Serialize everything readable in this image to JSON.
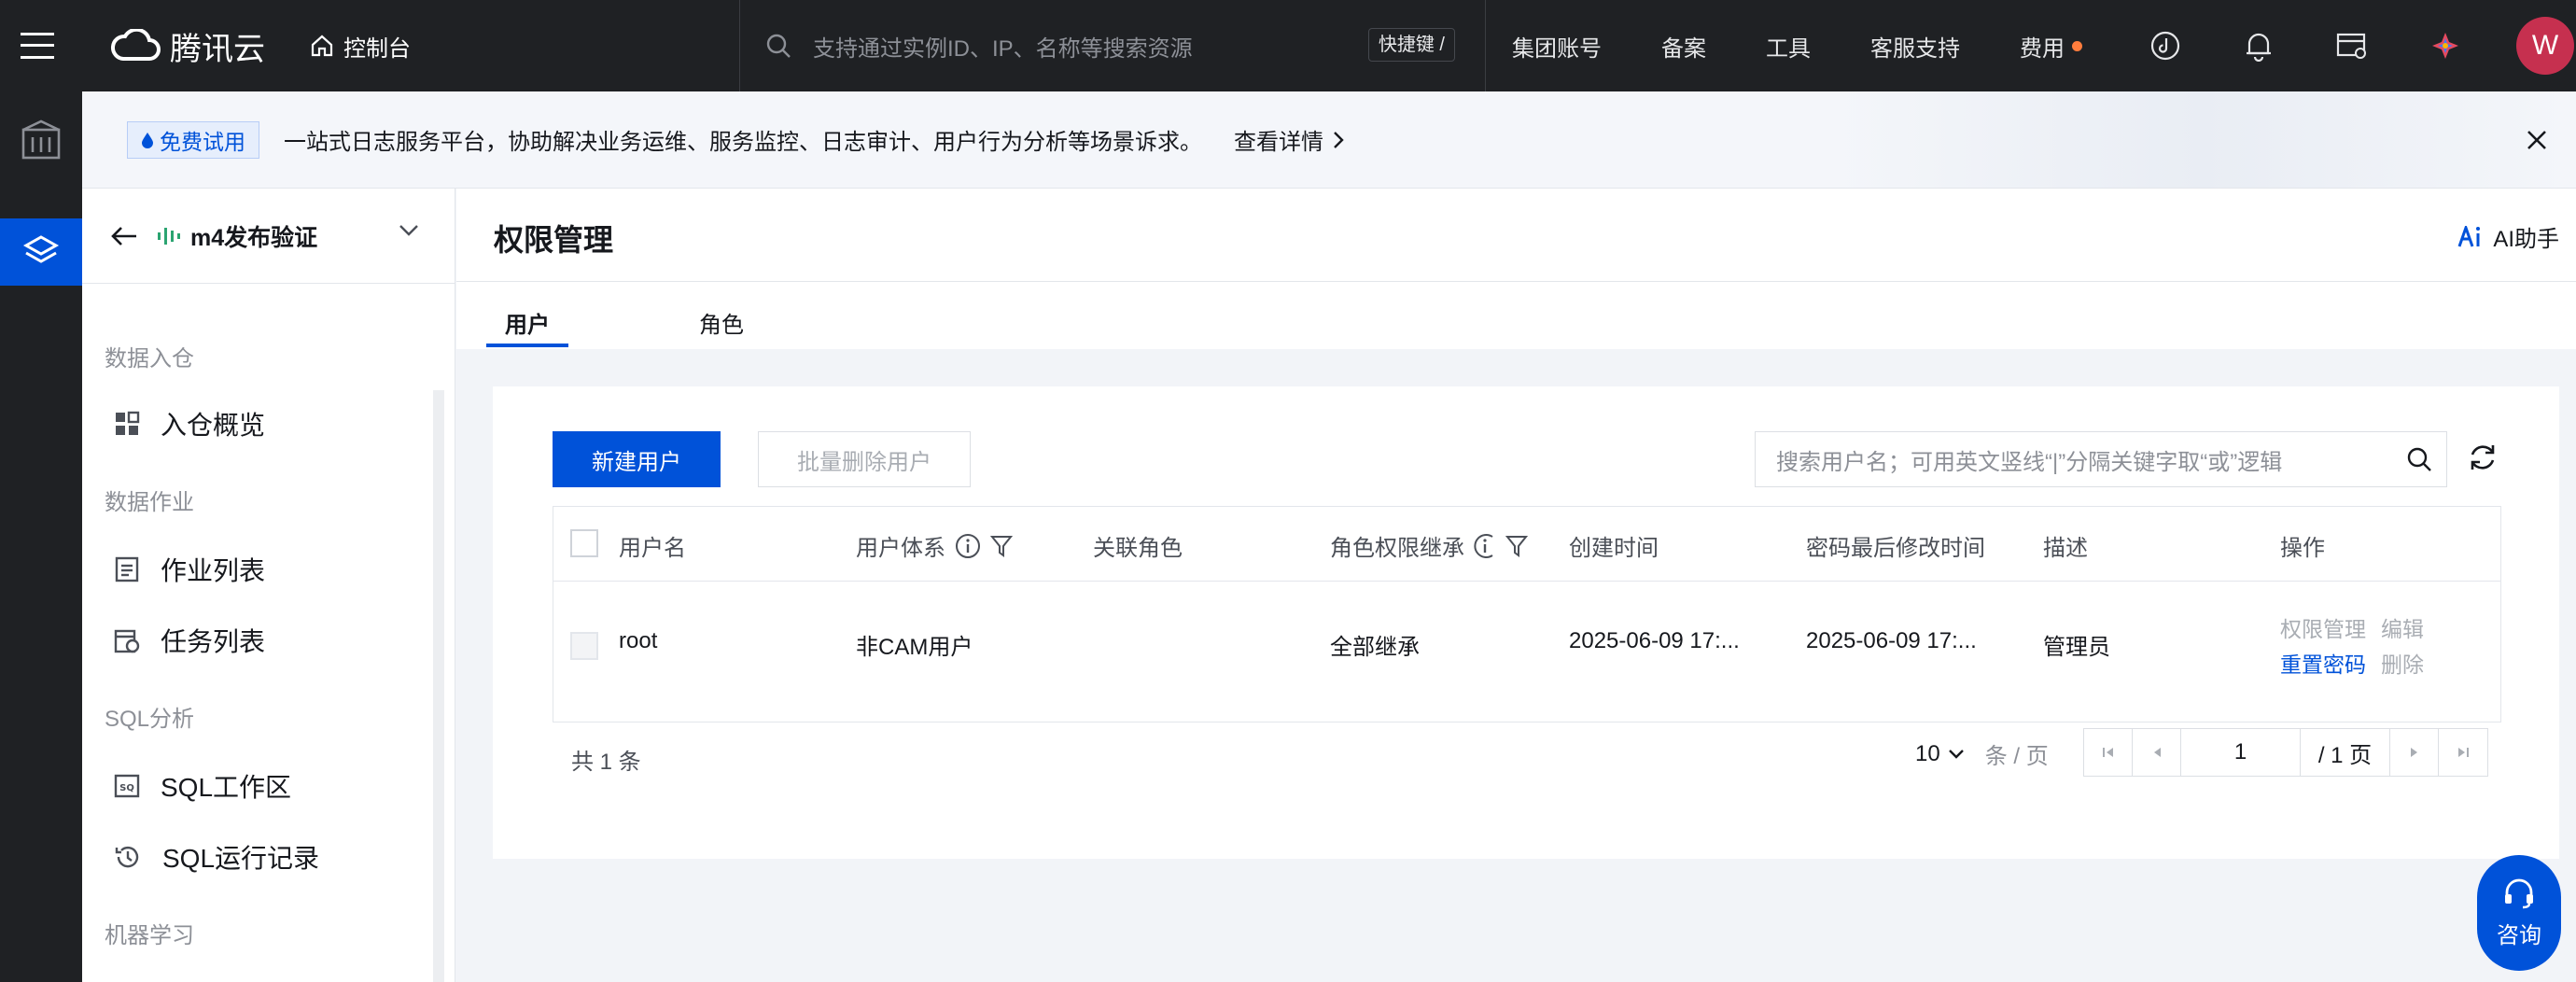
{
  "topbar": {
    "brand": "腾讯云",
    "console": "控制台",
    "search_placeholder": "支持通过实例ID、IP、名称等搜索资源",
    "shortcut": "快捷键 /",
    "nav": [
      "集团账号",
      "备案",
      "工具",
      "客服支持",
      "费用"
    ],
    "avatar_letter": "W"
  },
  "banner": {
    "badge": "免费试用",
    "text": "一站式日志服务平台，协助解决业务运维、服务监控、日志审计、用户行为分析等场景诉求。",
    "link": "查看详情"
  },
  "side": {
    "instance": "m4发布验证",
    "groups": {
      "ingest": "数据入仓",
      "jobs": "数据作业",
      "sql": "SQL分析",
      "ml": "机器学习"
    },
    "items": {
      "overview": "入仓概览",
      "job_list": "作业列表",
      "task_list": "任务列表",
      "sql_workspace": "SQL工作区",
      "sql_history": "SQL运行记录"
    }
  },
  "main": {
    "title": "权限管理",
    "ai_helper": "AI助手",
    "tabs": [
      "用户",
      "角色"
    ],
    "new_user": "新建用户",
    "batch_delete": "批量删除用户",
    "search_placeholder": "搜索用户名；可用英文竖线“|”分隔关键字取“或”逻辑",
    "columns": {
      "username": "用户名",
      "user_system": "用户体系",
      "roles": "关联角色",
      "inherit": "角色权限继承",
      "created": "创建时间",
      "pwd_modified": "密码最后修改时间",
      "desc": "描述",
      "ops": "操作"
    },
    "row": {
      "username": "root",
      "user_system": "非CAM用户",
      "roles": "",
      "inherit": "全部继承",
      "created": "2025-06-09 17:...",
      "pwd_modified": "2025-06-09 17:...",
      "desc": "管理员",
      "ops": {
        "perm": "权限管理",
        "edit": "编辑",
        "reset": "重置密码",
        "delete": "删除"
      }
    },
    "total": "共 1 条",
    "page_size": "10",
    "page_size_unit": "条 / 页",
    "page_current": "1",
    "page_total": "/ 1 页"
  },
  "consult": "咨询",
  "colors": {
    "brand_blue": "#0052d9",
    "topbar_bg": "#1f2124",
    "avatar": "#c6304f",
    "fee_dot": "#ff7d3d"
  }
}
